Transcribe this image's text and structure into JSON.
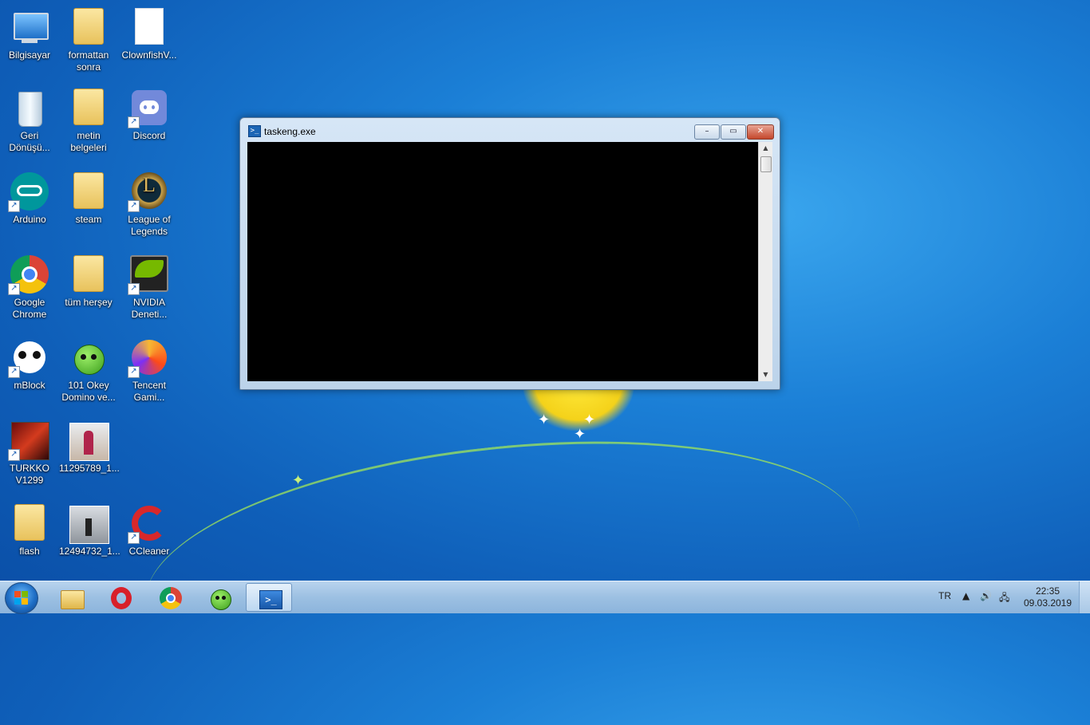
{
  "desktop": {
    "icons": [
      {
        "label": "Bilgisayar",
        "kind": "computer-icon"
      },
      {
        "label": "formattan\nsonra",
        "kind": "folder-icon"
      },
      {
        "label": "ClownfishV...",
        "kind": "file-icon"
      },
      {
        "label": "Geri\nDönüşü...",
        "kind": "recycle-bin-icon"
      },
      {
        "label": "metin\nbelgeleri",
        "kind": "folder-icon"
      },
      {
        "label": "Discord",
        "kind": "discord-icon"
      },
      {
        "label": "Arduino",
        "kind": "arduino-icon"
      },
      {
        "label": "steam",
        "kind": "folder-icon"
      },
      {
        "label": "League of\nLegends",
        "kind": "league-of-legends-icon"
      },
      {
        "label": "Google\nChrome",
        "kind": "chrome-icon"
      },
      {
        "label": "tüm herşey",
        "kind": "folder-icon"
      },
      {
        "label": "NVIDIA\nDeneti...",
        "kind": "nvidia-icon"
      },
      {
        "label": "mBlock",
        "kind": "mblock-icon"
      },
      {
        "label": "101 Okey\nDomino ve...",
        "kind": "okey-icon"
      },
      {
        "label": "Tencent\nGami...",
        "kind": "tencent-icon"
      },
      {
        "label": "TURKKO\nV1299",
        "kind": "game-icon"
      },
      {
        "label": "11295789_1...",
        "kind": "photo-icon"
      },
      {
        "label": "flash",
        "kind": "folder-icon"
      },
      {
        "label": "12494732_1...",
        "kind": "photo-icon"
      },
      {
        "label": "CCleaner",
        "kind": "ccleaner-icon"
      }
    ]
  },
  "window": {
    "title": "taskeng.exe",
    "minimize_symbol": "–",
    "maximize_symbol": "▭",
    "close_symbol": "✕",
    "scroll_up": "▲",
    "scroll_down": "▼"
  },
  "taskbar": {
    "items": [
      "explorer",
      "opera",
      "chrome",
      "okey",
      "powershell"
    ],
    "language": "TR",
    "time": "22:35",
    "date": "09.03.2019"
  },
  "colors": {
    "wallpaper": "#1b7fd6",
    "console_bg": "#000000",
    "close_button": "#c4472c"
  }
}
